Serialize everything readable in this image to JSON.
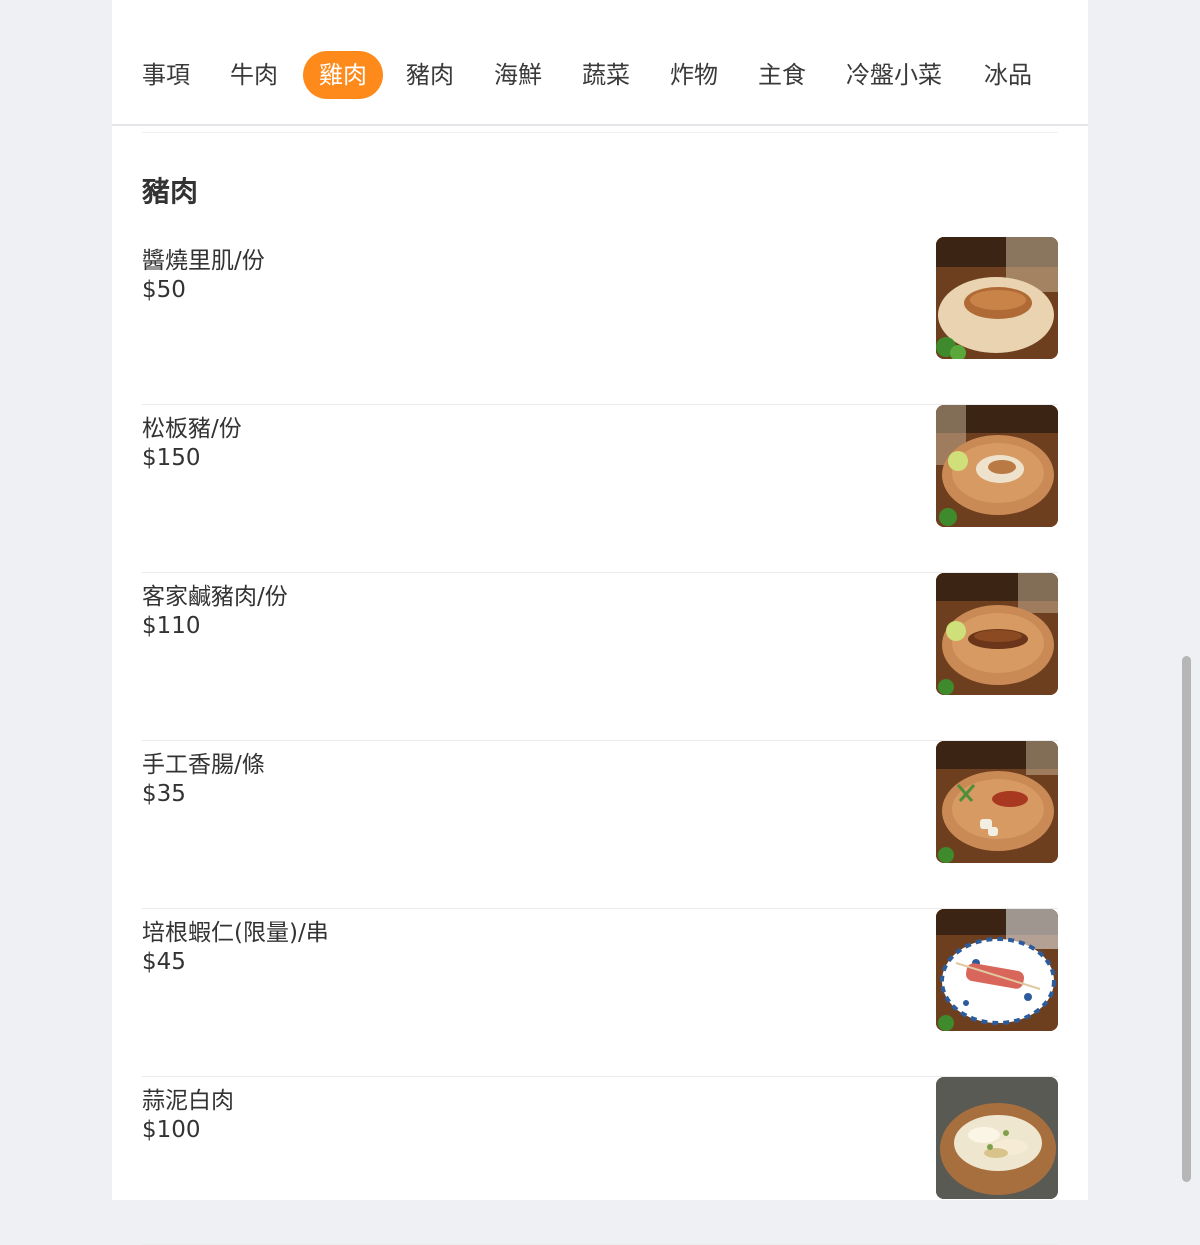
{
  "tabs": [
    {
      "label": "事項"
    },
    {
      "label": "牛肉"
    },
    {
      "label": "雞肉"
    },
    {
      "label": "豬肉"
    },
    {
      "label": "海鮮"
    },
    {
      "label": "蔬菜"
    },
    {
      "label": "炸物"
    },
    {
      "label": "主食"
    },
    {
      "label": "冷盤小菜"
    },
    {
      "label": "冰品"
    }
  ],
  "active_tab": "雞肉",
  "section": {
    "title": "豬肉"
  },
  "items": [
    {
      "name": "醬燒里肌/份",
      "price": "$50",
      "image": "grilled-pork-loin-photo"
    },
    {
      "name": "松板豬/份",
      "price": "$150",
      "image": "pork-jowl-photo"
    },
    {
      "name": "客家鹹豬肉/份",
      "price": "$110",
      "image": "hakka-salted-pork-photo"
    },
    {
      "name": "手工香腸/條",
      "price": "$35",
      "image": "sausage-photo"
    },
    {
      "name": "培根蝦仁(限量)/串",
      "price": "$45",
      "image": "bacon-shrimp-skewer-photo"
    },
    {
      "name": "蒜泥白肉",
      "price": "$100",
      "image": "garlic-pork-photo"
    }
  ],
  "colors": {
    "accent": "#ff8a1c",
    "background": "#eef0f3"
  }
}
